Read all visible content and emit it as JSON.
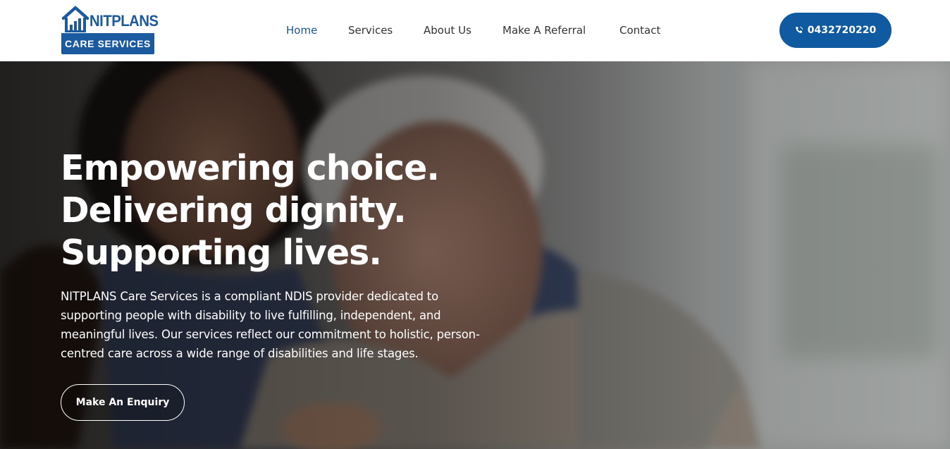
{
  "brand": {
    "name": "NITPLANS",
    "tagline": "CARE SERVICES",
    "primary_color": "#1c5aa0"
  },
  "nav": {
    "items": [
      {
        "label": "Home",
        "active": true
      },
      {
        "label": "Services",
        "active": false
      },
      {
        "label": "About Us",
        "active": false
      },
      {
        "label": "Make A Referral",
        "active": false
      },
      {
        "label": "Contact",
        "active": false
      }
    ],
    "active_color": "#1a5594"
  },
  "phone": {
    "number": "0432720220",
    "icon": "phone-icon",
    "bg_color": "#0f5aa0"
  },
  "hero": {
    "title_lines": [
      "Empowering choice.",
      "Delivering dignity.",
      "Supporting lives."
    ],
    "description": "NITPLANS Care Services is a compliant NDIS provider dedicated to supporting people with disability to live fulfilling, independent, and meaningful lives. Our services reflect our commitment to holistic, person-centred care across a wide range of disabilities and life stages.",
    "cta_label": "Make An Enquiry",
    "image_subject": "caregiver-hugging-elderly-woman-photo"
  }
}
